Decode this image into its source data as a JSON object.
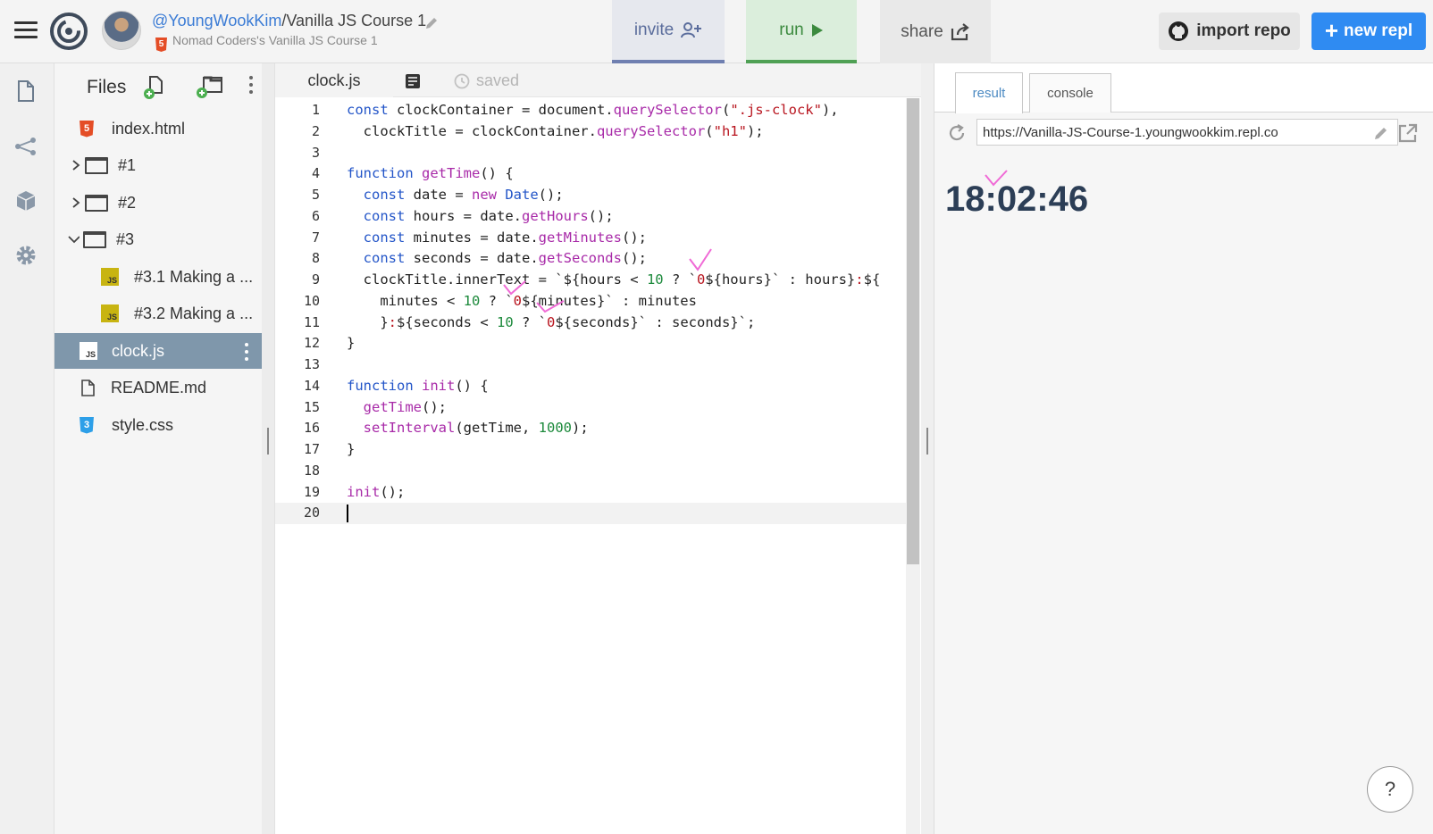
{
  "header": {
    "owner": "@YoungWookKim",
    "slash": "/",
    "repl_name": "Vanilla JS Course 1",
    "subtitle": "Nomad Coders's Vanilla JS Course 1",
    "invite_label": "invite",
    "run_label": "run",
    "share_label": "share",
    "import_label": "import repo",
    "new_repl_label": "new repl",
    "new_repl_plus": "+",
    "html5_glyph": "5"
  },
  "files": {
    "title": "Files",
    "items": [
      {
        "label": "index.html",
        "icon": "html5-icon"
      },
      {
        "label": "#1",
        "icon": "folder-icon"
      },
      {
        "label": "#2",
        "icon": "folder-icon"
      },
      {
        "label": "#3",
        "icon": "folder-icon"
      },
      {
        "label": "#3.1 Making a ...",
        "icon": "js-icon"
      },
      {
        "label": "#3.2 Making a ...",
        "icon": "js-icon"
      },
      {
        "label": "clock.js",
        "icon": "js-icon",
        "active": true
      },
      {
        "label": "README.md",
        "icon": "doc-icon"
      },
      {
        "label": "style.css",
        "icon": "css3-icon"
      }
    ],
    "js_glyph": "JS",
    "css_glyph": "3",
    "html_glyph": "5"
  },
  "editor": {
    "tab_label": "clock.js",
    "saved_label": "saved",
    "line_numbers": [
      "1",
      "2",
      "3",
      "4",
      "5",
      "6",
      "7",
      "8",
      "9",
      "10",
      "11",
      "12",
      "13",
      "14",
      "15",
      "16",
      "17",
      "18",
      "19",
      "20"
    ],
    "lines": [
      "const clockContainer = document.querySelector(\".js-clock\"),",
      "  clockTitle = clockContainer.querySelector(\"h1\");",
      "",
      "function getTime() {",
      "  const date = new Date();",
      "  const hours = date.getHours();",
      "  const minutes = date.getMinutes();",
      "  const seconds = date.getSeconds();",
      "  clockTitle.innerText = `${hours < 10 ? `0${hours}` : hours}:${",
      "    minutes < 10 ? `0${minutes}` : minutes",
      "    }:${seconds < 10 ? `0${seconds}` : seconds}`;",
      "}",
      "",
      "function init() {",
      "  getTime();",
      "  setInterval(getTime, 1000);",
      "}",
      "",
      "init();",
      ""
    ]
  },
  "result": {
    "result_tab": "result",
    "console_tab": "console",
    "url": "https://Vanilla-JS-Course-1.youngwookkim.repl.co",
    "clock_text": "18:02:46",
    "help_label": "?"
  },
  "colors": {
    "keyword": "#2355c8",
    "function": "#a82aa8",
    "string": "#b8141e",
    "number": "#1d8a3c",
    "new_repl_bg": "#2f8bf2",
    "run_green": "#4fa054",
    "invite_blue": "#6f7fb0",
    "active_file_bg": "#7f97ab",
    "annotation_pink": "#f06ad6"
  }
}
